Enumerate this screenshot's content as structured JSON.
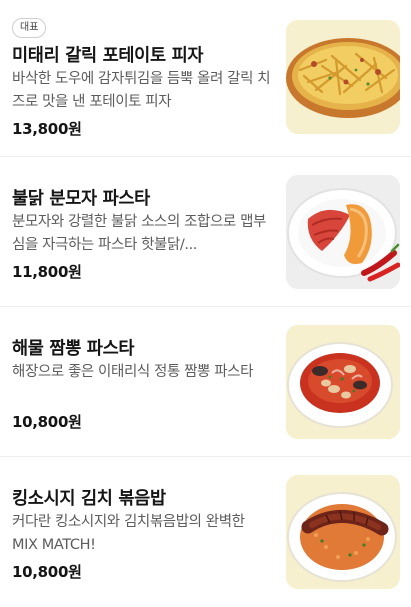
{
  "menu": {
    "items": [
      {
        "badge": "대표",
        "name": "미태리 갈릭 포테이토 피자",
        "description": "바삭한 도우에 감자튀김을 듬뿍 올려 갈릭 치즈로 맛을 낸 포테이토 피자",
        "price": "13,800원",
        "image_icon": "pizza-photo"
      },
      {
        "name": "불닭 분모자 파스타",
        "description": "분모자와 강렬한 불닭 소스의 조합으로 맵부심을 자극하는 파스타 핫불닭/...",
        "price": "11,800원",
        "image_icon": "spicy-pasta-photo"
      },
      {
        "name": "해물 짬뽕 파스타",
        "description": "해장으로 좋은 이태리식 정통 짬뽕 파스타",
        "price": "10,800원",
        "image_icon": "seafood-pasta-photo"
      },
      {
        "name": "킹소시지 김치 볶음밥",
        "description": "커다란 킹소시지와 김치볶음밥의 완벽한 MIX MATCH!",
        "price": "10,800원",
        "image_icon": "sausage-rice-photo"
      }
    ]
  }
}
